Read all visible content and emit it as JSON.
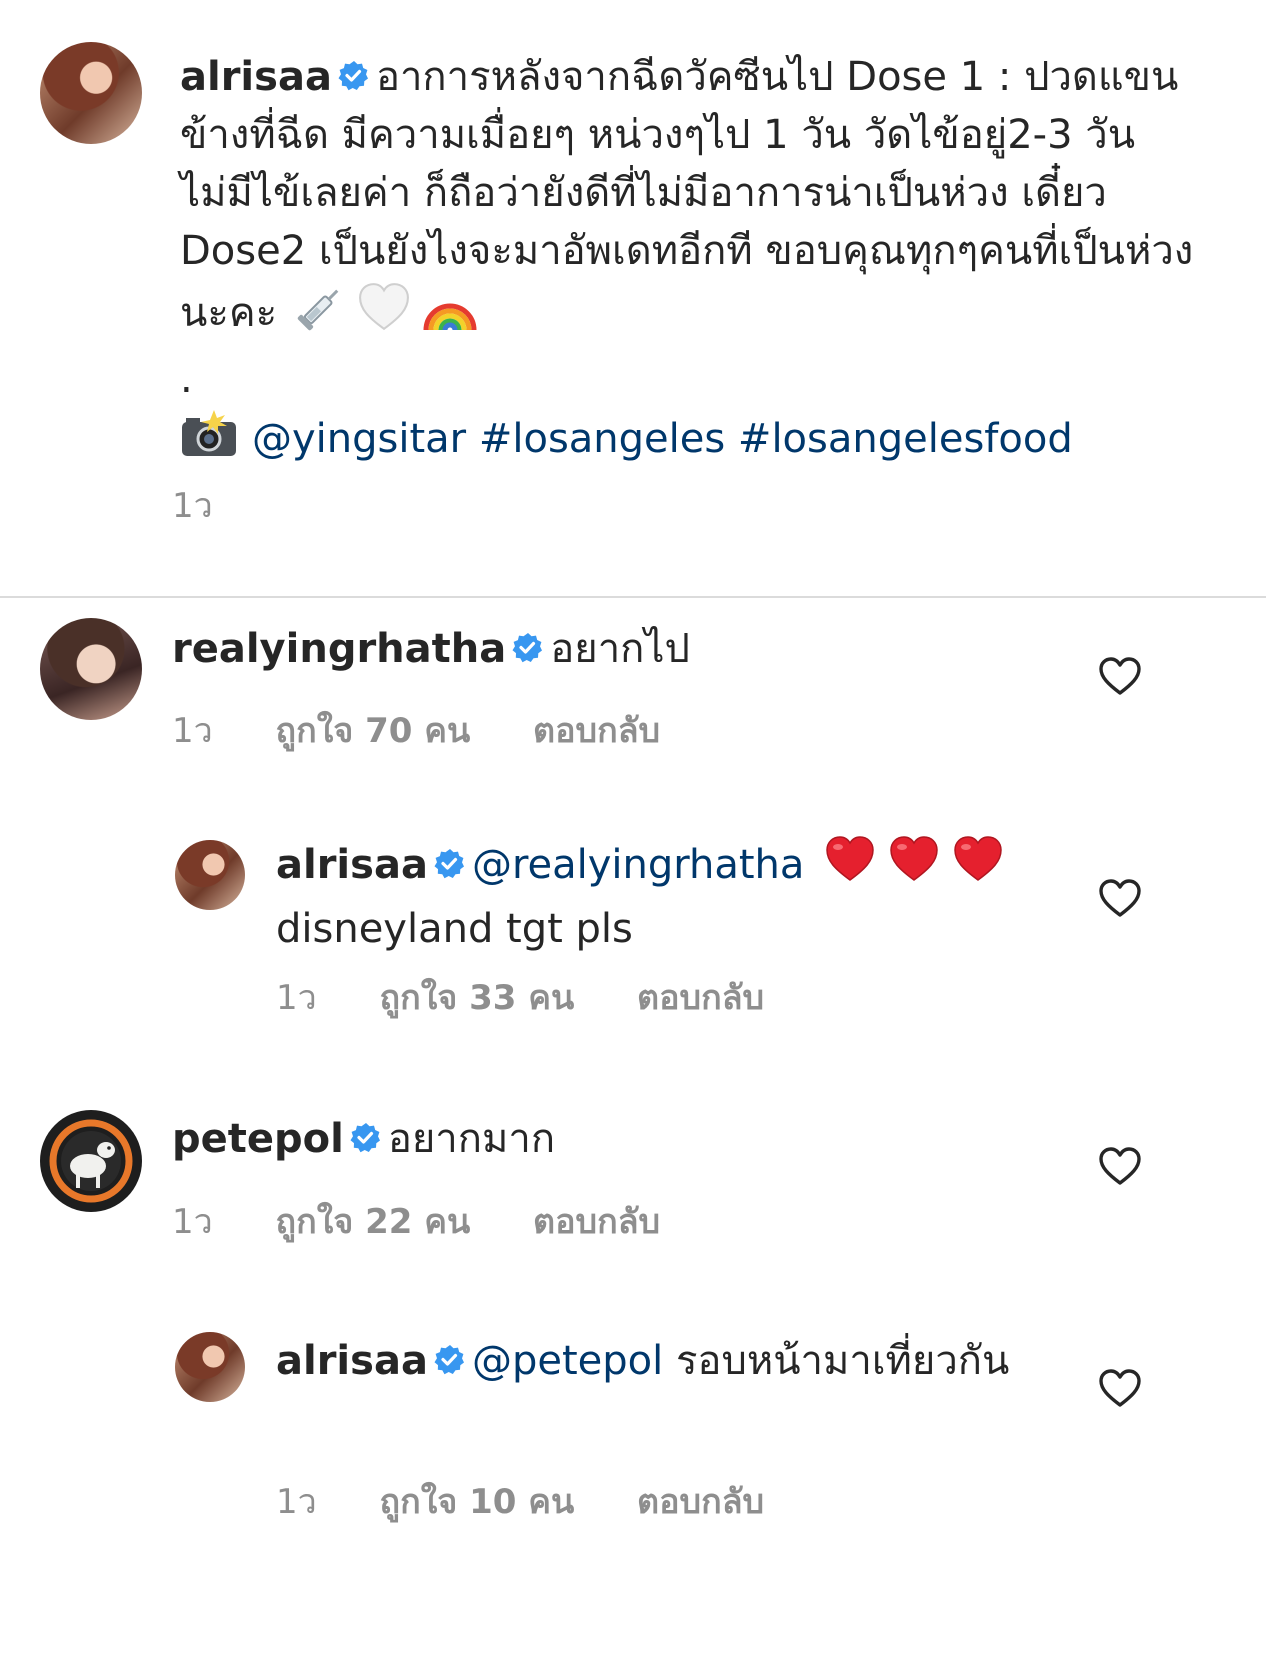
{
  "post": {
    "username": "alrisaa",
    "caption": "อาการหลังจากฉีดวัคซีนไป Dose 1 : ปวดแขนข้างที่ฉีด มีความเมื่อยๆ หน่วงๆไป 1 วัน วัดไข้อยู่2-3 วัน ไม่มีไข้เลยค่า ก็ถือว่ายังดีที่ไม่มีอาการน่าเป็นห่วง เดี๋ยว Dose2 เป็นยังไงจะมาอัพเดทอีกที ขอบคุณทุกๆคนที่เป็นห่วงนะคะ",
    "dot": ".",
    "credit_mention": "@yingsitar",
    "hashtags": "#losangeles #losangelesfood",
    "time": "1ว"
  },
  "comments": [
    {
      "username": "realyingrhatha",
      "text": "อยากไป",
      "time": "1ว",
      "likes": "ถูกใจ 70 คน",
      "reply": "ตอบกลับ"
    },
    {
      "username": "alrisaa",
      "mention": "@realyingrhatha",
      "text": "disneyland tgt pls",
      "time": "1ว",
      "likes": "ถูกใจ 33 คน",
      "reply": "ตอบกลับ"
    },
    {
      "username": "petepol",
      "text": "อยากมาก",
      "time": "1ว",
      "likes": "ถูกใจ 22 คน",
      "reply": "ตอบกลับ"
    },
    {
      "username": "alrisaa",
      "mention": "@petepol",
      "text": "รอบหน้ามาเที่ยวกัน",
      "time": "1ว",
      "likes": "ถูกใจ 10 คน",
      "reply": "ตอบกลับ"
    }
  ],
  "colors": {
    "verified": "#3897f0",
    "link": "#00376b",
    "meta": "#8e8e8e",
    "divider": "#dbdbdb"
  },
  "icons": [
    "verified-badge-icon",
    "syringe-emoji",
    "white-heart-emoji",
    "rainbow-emoji",
    "camera-flash-emoji",
    "red-heart-emoji",
    "heart-outline-icon"
  ]
}
